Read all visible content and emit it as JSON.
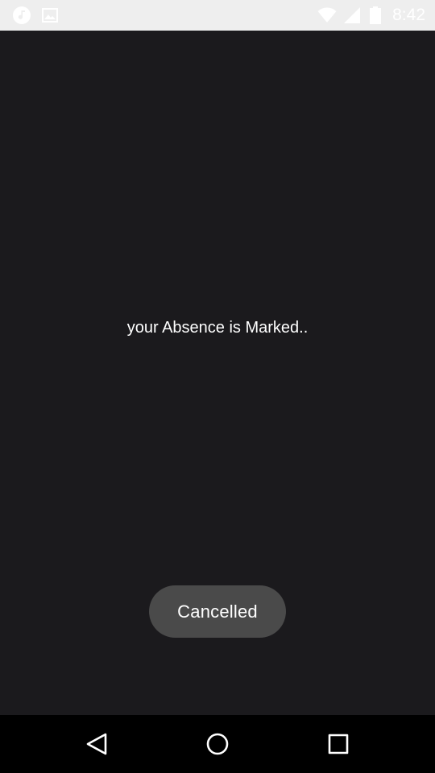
{
  "status_bar": {
    "time": "8:42",
    "icons": [
      "music-note-icon",
      "image-icon",
      "wifi-icon",
      "cell-signal-icon",
      "battery-icon"
    ]
  },
  "main": {
    "message": "your Absence is Marked.."
  },
  "toast": {
    "text": "Cancelled"
  },
  "nav_bar": {
    "icons": [
      "back-icon",
      "home-icon",
      "recent-apps-icon"
    ]
  },
  "colors": {
    "background": "#1b1a1d",
    "status_bar": "#eeeeee",
    "toast": "#4a4a4a",
    "nav_bar": "#000000",
    "text": "#ffffff"
  }
}
